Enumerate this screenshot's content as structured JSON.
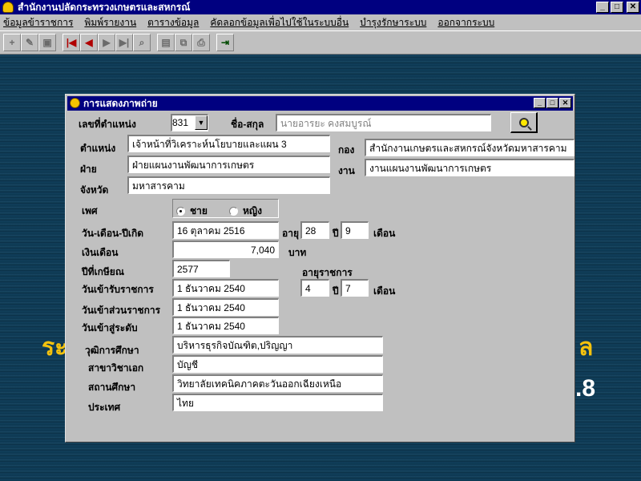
{
  "app": {
    "title": "สำนักงานปลัดกระทรวงเกษตรและสหกรณ์",
    "window_buttons": [
      "_",
      "□",
      "✕"
    ]
  },
  "menu": [
    "ข้อมูลข้าราชการ",
    "พิมพ์รายงาน",
    "ตารางข้อมูล",
    "คัดลอกข้อมูลเพื่อไปใช้ในระบบอื่น",
    "บำรุงรักษาระบบ",
    "ออกจากระบบ"
  ],
  "toolbar": {
    "icons": [
      "add-icon",
      "edit-icon",
      "save-icon",
      "first-record-icon",
      "previous-record-icon",
      "next-record-icon",
      "last-record-icon",
      "find-icon",
      "print-preview-icon",
      "copy-icon",
      "print-icon",
      "exit-door-icon"
    ]
  },
  "background": {
    "left_text": "ระ",
    "right_text": "ล",
    "number_text": ".8"
  },
  "form": {
    "title": "การแสดงภาพถ่าย",
    "position_no_label": "เลขที่ตำแหน่ง",
    "position_no_value": "831",
    "name_label": "ชื่อ-สกุล",
    "name_value": "นายอารยะ            คงสมบูรณ์",
    "position_label": "ตำแหน่ง",
    "position_value": "เจ้าหน้าที่วิเคราะห์นโยบายและแผน  3",
    "division_label": "กอง",
    "division_value": "สำนักงานเกษตรและสหกรณ์จังหวัดมหาสารคาม",
    "section_label": "ฝ่าย",
    "section_value": "ฝ่ายแผนงานพัฒนาการเกษตร",
    "work_label": "งาน",
    "work_value": "งานแผนงานพัฒนาการเกษตร",
    "province_label": "จังหวัด",
    "province_value": "มหาสารคาม",
    "sex_label": "เพศ",
    "sex_male": "ชาย",
    "sex_female": "หญิง",
    "birth_label": "วัน-เดือน-ปีเกิด",
    "birth_value": "16 ตุลาคม 2516",
    "age_label": "อายุ",
    "age_years": "28",
    "year_label": "ปี",
    "age_months": "9",
    "month_label": "เดือน",
    "salary_label": "เงินเดือน",
    "salary_value": "7,040",
    "baht_label": "บาท",
    "retire_label": "ปีที่เกษียณ",
    "retire_value": "2577",
    "service_label": "อายุราชการ",
    "entry_label": "วันเข้ารับราชการ",
    "entry_value": "1 ธันวาคม 2540",
    "service_years": "4",
    "service_year_label": "ปี",
    "service_months": "7",
    "service_month_label": "เดือน",
    "agency_entry_label": "วันเข้าส่วนราชการ",
    "agency_entry_value": "1 ธันวาคม 2540",
    "level_entry_label": "วันเข้าสู่ระดับ",
    "level_entry_value": "1 ธันวาคม 2540",
    "degree_label": "วุฒิการศึกษา",
    "degree_value": "บริหารธุรกิจบัณฑิต,ปริญญา",
    "major_label": "สาขาวิชาเอก",
    "major_value": "บัญชี",
    "institute_label": "สถานศึกษา",
    "institute_value": "วิทยาลัยเทคนิคภาคตะวันออกเฉียงเหนือ",
    "country_label": "ประเทศ",
    "country_value": "ไทย"
  }
}
